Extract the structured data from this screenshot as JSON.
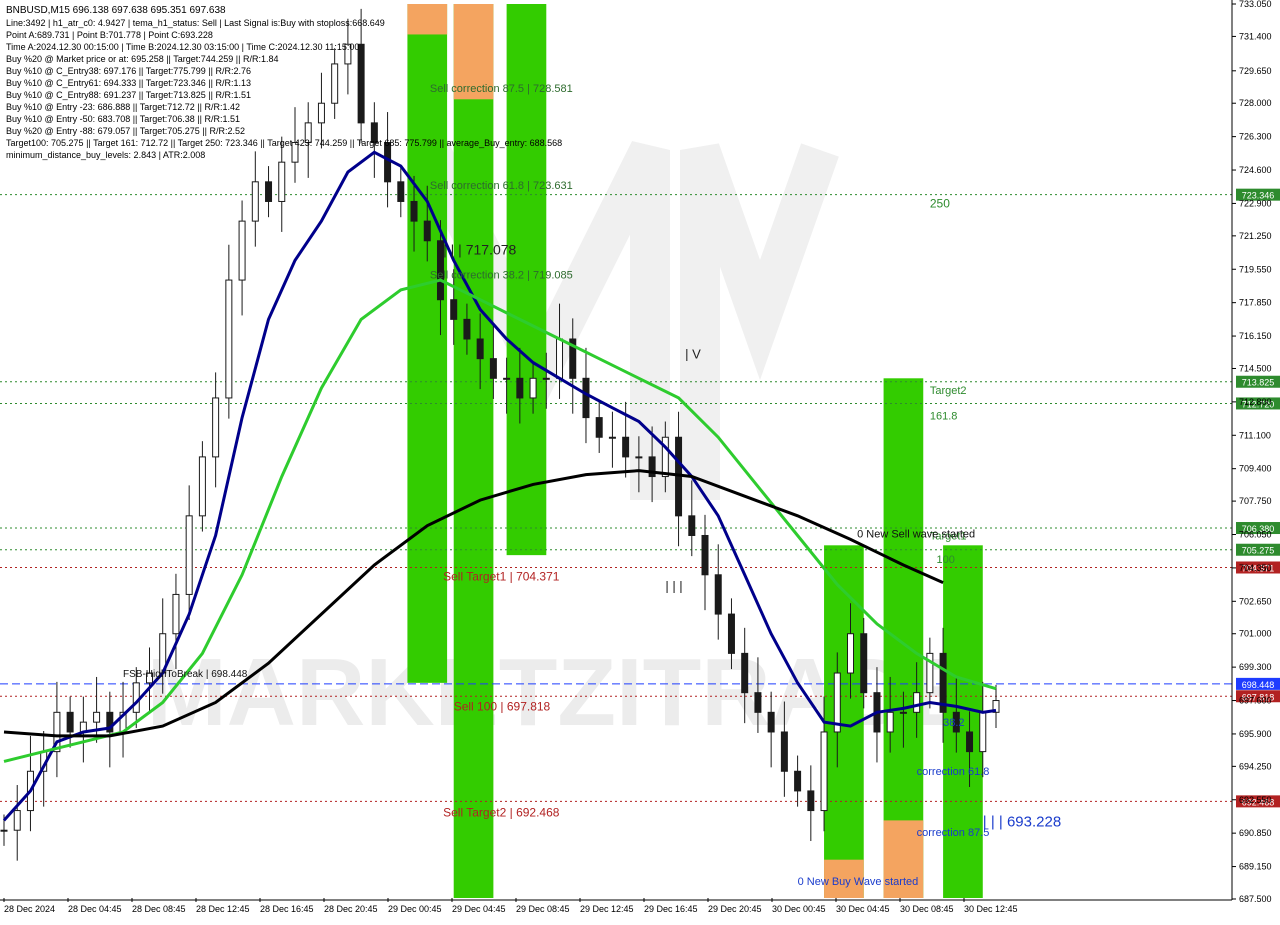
{
  "header": {
    "title": "BNBUSD,M15  696.138 697.638 695.351 697.638",
    "lines": [
      "Line:3492 | h1_atr_c0: 4.9427 | tema_h1_status: Sell | Last Signal is:Buy with stoploss:668.649",
      "Point A:689.731 | Point B:701.778 | Point C:693.228",
      "Time A:2024.12.30 00:15:00 | Time B:2024.12.30 03:15:00 | Time C:2024.12.30 11:15:00",
      "Buy %20 @ Market price or at: 695.258 || Target:744.259 || R/R:1.84",
      "Buy %10 @ C_Entry38: 697.176 || Target:775.799 || R/R:2.76",
      "Buy %10 @ C_Entry61: 694.333 || Target:723.346 || R/R:1.13",
      "Buy %10 @ C_Entry88: 691.237 || Target:713.825 || R/R:1.51",
      "Buy %10 @ Entry -23: 686.888 || Target:712.72 || R/R:1.42",
      "Buy %10 @ Entry -50: 683.708 || Target:706.38 || R/R:1.51",
      "Buy %20 @ Entry -88: 679.057 || Target:705.275 || R/R:2.52",
      "Target100: 705.275 || Target 161: 712.72 || Target 250: 723.346 || Target 423: 744.259 || Target 685: 775.799 || average_Buy_entry: 688.568",
      "minimum_distance_buy_levels: 2.843 | ATR:2.008"
    ]
  },
  "watermark": "MARKETZITRADE",
  "chart_data": {
    "type": "candlestick",
    "symbol": "BNBUSD",
    "timeframe": "M15",
    "ylim": [
      687.55,
      733.05
    ],
    "y_ticks": [
      733.05,
      731.4,
      729.65,
      728.0,
      726.3,
      724.6,
      722.9,
      721.25,
      719.55,
      717.85,
      716.15,
      714.5,
      712.8,
      711.1,
      709.4,
      707.75,
      706.05,
      704.35,
      702.65,
      701.0,
      699.3,
      697.6,
      695.9,
      694.25,
      692.55,
      690.85,
      689.15,
      687.5
    ],
    "y_tick_labels": [
      "733.050",
      "731.400",
      "729.650",
      "728.000",
      "726.300",
      "724.600",
      "722.900",
      "721.250",
      "719.550",
      "717.850",
      "716.150",
      "714.500",
      "712.800",
      "711.100",
      "709.400",
      "707.750",
      "706.050",
      "704.350",
      "702.650",
      "701.000",
      "699.300",
      "697.600",
      "695.900",
      "694.250",
      "692.550",
      "690.850",
      "689.150",
      "687.500"
    ],
    "x_ticks": [
      "28 Dec 2024",
      "28 Dec 04:45",
      "28 Dec 08:45",
      "28 Dec 12:45",
      "28 Dec 16:45",
      "28 Dec 20:45",
      "29 Dec 00:45",
      "29 Dec 04:45",
      "29 Dec 08:45",
      "29 Dec 12:45",
      "29 Dec 16:45",
      "29 Dec 20:45",
      "30 Dec 00:45",
      "30 Dec 04:45",
      "30 Dec 08:45",
      "30 Dec 12:45"
    ],
    "price_path": [
      [
        0,
        691
      ],
      [
        1,
        692
      ],
      [
        2,
        694
      ],
      [
        3,
        695
      ],
      [
        4,
        697
      ],
      [
        5,
        696
      ],
      [
        6,
        696.5
      ],
      [
        7,
        697
      ],
      [
        8,
        696
      ],
      [
        9,
        697
      ],
      [
        10,
        698.5
      ],
      [
        11,
        699
      ],
      [
        12,
        701
      ],
      [
        13,
        703
      ],
      [
        14,
        707
      ],
      [
        15,
        710
      ],
      [
        16,
        713
      ],
      [
        17,
        719
      ],
      [
        18,
        722
      ],
      [
        19,
        724
      ],
      [
        20,
        723
      ],
      [
        21,
        725
      ],
      [
        22,
        726
      ],
      [
        23,
        727
      ],
      [
        24,
        728
      ],
      [
        25,
        730
      ],
      [
        26,
        731
      ],
      [
        27,
        727
      ],
      [
        28,
        726
      ],
      [
        29,
        724
      ],
      [
        30,
        723
      ],
      [
        31,
        722
      ],
      [
        32,
        721
      ],
      [
        33,
        718
      ],
      [
        34,
        717
      ],
      [
        35,
        716
      ],
      [
        36,
        715
      ],
      [
        37,
        714
      ],
      [
        38,
        714
      ],
      [
        39,
        713
      ],
      [
        40,
        714
      ],
      [
        41,
        714
      ],
      [
        42,
        716
      ],
      [
        43,
        714
      ],
      [
        44,
        712
      ],
      [
        45,
        711
      ],
      [
        46,
        711
      ],
      [
        47,
        710
      ],
      [
        48,
        710
      ],
      [
        49,
        709
      ],
      [
        50,
        711
      ],
      [
        51,
        707
      ],
      [
        52,
        706
      ],
      [
        53,
        704
      ],
      [
        54,
        702
      ],
      [
        55,
        700
      ],
      [
        56,
        698
      ],
      [
        57,
        697
      ],
      [
        58,
        696
      ],
      [
        59,
        694
      ],
      [
        60,
        693
      ],
      [
        61,
        692
      ],
      [
        62,
        696
      ],
      [
        63,
        699
      ],
      [
        64,
        701
      ],
      [
        65,
        698
      ],
      [
        66,
        696
      ],
      [
        67,
        697
      ],
      [
        68,
        697
      ],
      [
        69,
        698
      ],
      [
        70,
        700
      ],
      [
        71,
        697
      ],
      [
        72,
        696
      ],
      [
        73,
        695
      ],
      [
        74,
        697
      ],
      [
        75,
        697.6
      ]
    ],
    "series": [
      {
        "name": "",
        "color": "#00008b",
        "values": [
          [
            0,
            691.5
          ],
          [
            2,
            693
          ],
          [
            4,
            695.5
          ],
          [
            6,
            696
          ],
          [
            8,
            696.2
          ],
          [
            10,
            697.5
          ],
          [
            12,
            699
          ],
          [
            14,
            702
          ],
          [
            16,
            706
          ],
          [
            18,
            712
          ],
          [
            20,
            717
          ],
          [
            22,
            720
          ],
          [
            24,
            722
          ],
          [
            26,
            724.5
          ],
          [
            28,
            725.5
          ],
          [
            30,
            724.8
          ],
          [
            32,
            723
          ],
          [
            34,
            720
          ],
          [
            36,
            717.5
          ],
          [
            38,
            716
          ],
          [
            40,
            714.8
          ],
          [
            42,
            714
          ],
          [
            44,
            713.2
          ],
          [
            46,
            712.5
          ],
          [
            48,
            711.8
          ],
          [
            50,
            710.5
          ],
          [
            52,
            709
          ],
          [
            54,
            707
          ],
          [
            56,
            704
          ],
          [
            58,
            701
          ],
          [
            60,
            698.5
          ],
          [
            62,
            696.5
          ],
          [
            64,
            696.3
          ],
          [
            66,
            697
          ],
          [
            68,
            697.2
          ],
          [
            70,
            697.5
          ],
          [
            72,
            697.3
          ],
          [
            74,
            697
          ],
          [
            75,
            697.1
          ]
        ]
      },
      {
        "name": "",
        "color": "#2ecc2e",
        "values": [
          [
            0,
            694.5
          ],
          [
            3,
            695
          ],
          [
            6,
            695.5
          ],
          [
            9,
            696
          ],
          [
            12,
            697.5
          ],
          [
            15,
            700
          ],
          [
            18,
            704
          ],
          [
            21,
            709
          ],
          [
            24,
            713.5
          ],
          [
            27,
            717
          ],
          [
            30,
            718.5
          ],
          [
            33,
            719
          ],
          [
            36,
            718
          ],
          [
            39,
            717
          ],
          [
            42,
            716
          ],
          [
            45,
            715
          ],
          [
            48,
            714
          ],
          [
            51,
            713
          ],
          [
            54,
            711
          ],
          [
            57,
            708.5
          ],
          [
            60,
            706
          ],
          [
            63,
            703.5
          ],
          [
            66,
            701.5
          ],
          [
            69,
            700
          ],
          [
            72,
            698.8
          ],
          [
            75,
            698.2
          ]
        ]
      },
      {
        "name": "",
        "color": "#000000",
        "values": [
          [
            0,
            696
          ],
          [
            4,
            695.8
          ],
          [
            8,
            695.8
          ],
          [
            12,
            696.3
          ],
          [
            16,
            697.5
          ],
          [
            20,
            699.5
          ],
          [
            24,
            702
          ],
          [
            28,
            704.5
          ],
          [
            32,
            706.5
          ],
          [
            36,
            707.8
          ],
          [
            40,
            708.6
          ],
          [
            44,
            709.1
          ],
          [
            48,
            709.3
          ],
          [
            52,
            709
          ],
          [
            56,
            708
          ],
          [
            60,
            707
          ],
          [
            64,
            705.8
          ],
          [
            68,
            704.5
          ],
          [
            71,
            703.6
          ]
        ]
      }
    ],
    "horizontal_levels": [
      {
        "value": 723.346,
        "label": "723.346",
        "color": "#2e8b2e",
        "style": "dotted"
      },
      {
        "value": 713.825,
        "label": "713.825",
        "color": "#2e8b2e",
        "style": "dotted"
      },
      {
        "value": 712.72,
        "label": "712.720",
        "color": "#2e8b2e",
        "style": "dotted"
      },
      {
        "value": 706.38,
        "label": "706.380",
        "color": "#2e8b2e",
        "style": "dotted"
      },
      {
        "value": 705.275,
        "label": "705.275",
        "color": "#2e8b2e",
        "style": "dotted"
      },
      {
        "value": 704.371,
        "label": "704.371",
        "color": "#b22222",
        "style": "dotted"
      },
      {
        "value": 698.448,
        "label": "698.448",
        "color": "#1e3cff",
        "style": "dashed"
      },
      {
        "value": 697.818,
        "label": "697.818",
        "color": "#b22222",
        "style": "dotted"
      },
      {
        "value": 692.468,
        "label": "692.468",
        "color": "#b22222",
        "style": "dotted"
      }
    ],
    "zones": [
      {
        "x0": 30.5,
        "x1": 33.5,
        "y0": 698.5,
        "y1": 733.05,
        "color": "#33cc00"
      },
      {
        "x0": 34,
        "x1": 37,
        "y0": 687.55,
        "y1": 733.05,
        "color": "#33cc00"
      },
      {
        "x0": 30.5,
        "x1": 33.5,
        "y0": 731.5,
        "y1": 733.05,
        "color": "#f4a460"
      },
      {
        "x0": 34,
        "x1": 37,
        "y0": 728.2,
        "y1": 733.05,
        "color": "#f4a460"
      },
      {
        "x0": 38,
        "x1": 41,
        "y0": 705,
        "y1": 733.05,
        "color": "#33cc00"
      },
      {
        "x0": 62,
        "x1": 65,
        "y0": 687.55,
        "y1": 705.5,
        "color": "#33cc00"
      },
      {
        "x0": 62,
        "x1": 65,
        "y0": 687.55,
        "y1": 689.5,
        "color": "#f4a460"
      },
      {
        "x0": 66.5,
        "x1": 69.5,
        "y0": 687.55,
        "y1": 714,
        "color": "#33cc00"
      },
      {
        "x0": 66.5,
        "x1": 69.5,
        "y0": 687.55,
        "y1": 691.5,
        "color": "#f4a460"
      },
      {
        "x0": 71,
        "x1": 74,
        "y0": 687.55,
        "y1": 705.5,
        "color": "#33cc00"
      }
    ],
    "annotations": [
      {
        "text": "Sell correction 87.5 | 728.581",
        "x": 32.2,
        "y": 728.581,
        "color": "#2e6b2e",
        "size": 11
      },
      {
        "text": "Sell correction 61.8 | 723.631",
        "x": 32.2,
        "y": 723.631,
        "color": "#2e6b2e",
        "size": 11
      },
      {
        "text": "Sell correction 38.2 | 719.085",
        "x": 32.2,
        "y": 719.085,
        "color": "#2e6b2e",
        "size": 11
      },
      {
        "text": "| | | 717.078",
        "x": 33.2,
        "y": 720.3,
        "color": "#222222",
        "size": 14
      },
      {
        "text": "Sell Target1 | 704.371",
        "x": 33.2,
        "y": 703.7,
        "color": "#b22222",
        "size": 12
      },
      {
        "text": "Sell 100 | 697.818",
        "x": 34,
        "y": 697.1,
        "color": "#b22222",
        "size": 12
      },
      {
        "text": "Sell Target2 | 692.468",
        "x": 33.2,
        "y": 691.7,
        "color": "#b22222",
        "size": 12
      },
      {
        "text": "| V",
        "x": 51.5,
        "y": 715,
        "color": "#222222",
        "size": 13
      },
      {
        "text": "| | |",
        "x": 50,
        "y": 703.2,
        "color": "#222222",
        "size": 13
      },
      {
        "text": "250",
        "x": 70,
        "y": 722.7,
        "color": "#2e8b2e",
        "size": 12
      },
      {
        "text": "Target2",
        "x": 70,
        "y": 713.2,
        "color": "#2e8b2e",
        "size": 11
      },
      {
        "text": "161.8",
        "x": 70,
        "y": 711.9,
        "color": "#2e8b2e",
        "size": 11
      },
      {
        "text": "Target1",
        "x": 70,
        "y": 705.8,
        "color": "#2e8b2e",
        "size": 11
      },
      {
        "text": "100",
        "x": 70.5,
        "y": 704.6,
        "color": "#2e8b2e",
        "size": 11
      },
      {
        "text": "0 New Sell wave started",
        "x": 64.5,
        "y": 705.9,
        "color": "#111111",
        "size": 11
      },
      {
        "text": "correction 61.8",
        "x": 69,
        "y": 693.8,
        "color": "#1a3ccc",
        "size": 11
      },
      {
        "text": "correction 87.5",
        "x": 69,
        "y": 690.7,
        "color": "#1a3ccc",
        "size": 11
      },
      {
        "text": "| | | 693.228",
        "x": 74,
        "y": 691.2,
        "color": "#1a3ccc",
        "size": 15
      },
      {
        "text": "0 New Buy Wave started",
        "x": 60,
        "y": 688.2,
        "color": "#1a3ccc",
        "size": 11
      },
      {
        "text": "38.2",
        "x": 71,
        "y": 696.3,
        "color": "#1a3ccc",
        "size": 11
      },
      {
        "text": "FSB-HighToBreak | 698.448",
        "x": 9,
        "y": 698.8,
        "color": "#111111",
        "size": 10
      }
    ]
  }
}
